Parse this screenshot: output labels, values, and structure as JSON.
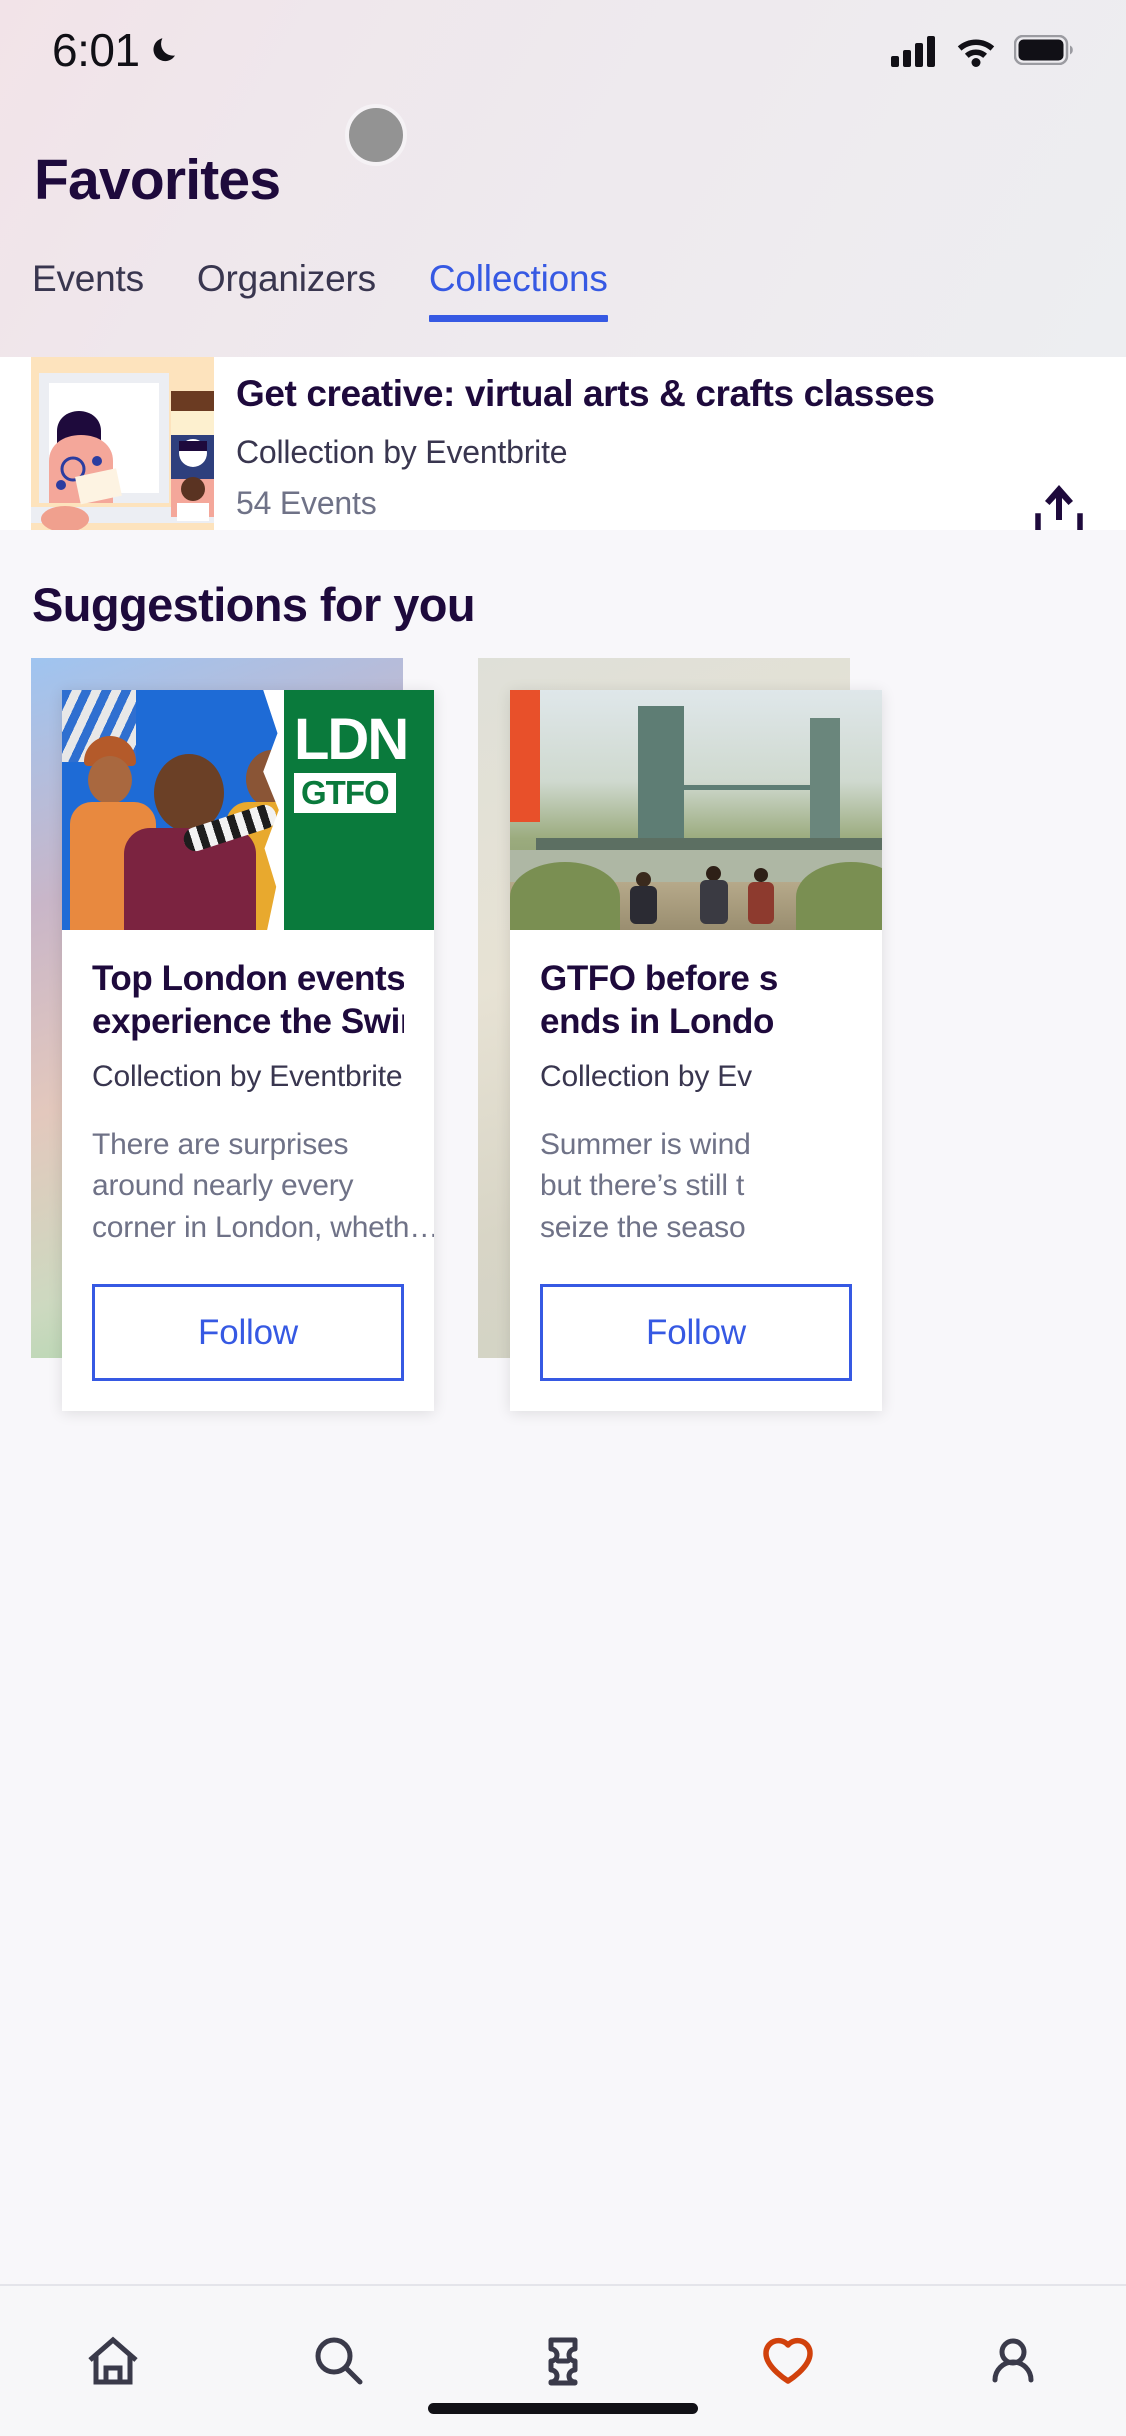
{
  "status_bar": {
    "time": "6:01",
    "moon_icon": "crescent-moon-icon",
    "cellular_icon": "cellular-signal-icon",
    "wifi_icon": "wifi-icon",
    "battery_icon": "battery-full-icon"
  },
  "header": {
    "title": "Favorites",
    "avatar": "user-avatar"
  },
  "tabs": [
    {
      "label": "Events",
      "active": false
    },
    {
      "label": "Organizers",
      "active": false
    },
    {
      "label": "Collections",
      "active": true
    }
  ],
  "saved_collection": {
    "thumbnail": "arts-crafts-illustration",
    "title": "Get creative: virtual arts & crafts classes",
    "subtitle": "Collection by Eventbrite",
    "count": "54 Events",
    "share_icon": "share-upload-icon"
  },
  "suggestions": {
    "heading": "Suggestions for you",
    "cards": [
      {
        "image": "ldn-gtfo-artwork",
        "image_text_primary": "LDN",
        "image_text_secondary": "GTFO",
        "title_line1": "Top London events:",
        "title_line2": "experience the Swin…",
        "subtitle": "Collection by Eventbrite",
        "desc_line1": "There are surprises",
        "desc_line2": "around nearly every",
        "desc_line3": "corner in London, wheth…",
        "button": "Follow"
      },
      {
        "image": "hammersmith-bridge-photo",
        "title_line1": "GTFO before s",
        "title_line2": "ends in Londo",
        "subtitle": "Collection by Ev",
        "desc_line1": "Summer is wind",
        "desc_line2": "but there’s still t",
        "desc_line3": "seize the seaso",
        "button": "Follow"
      }
    ]
  },
  "bottom_nav": [
    {
      "icon": "home-icon",
      "active": false
    },
    {
      "icon": "search-icon",
      "active": false
    },
    {
      "icon": "ticket-icon",
      "active": false
    },
    {
      "icon": "heart-icon",
      "active": true
    },
    {
      "icon": "profile-icon",
      "active": false
    }
  ],
  "colors": {
    "brand_blue": "#3659e3",
    "brand_purple": "#1e0a3c",
    "heart_red": "#d1410c",
    "muted_text": "#6f7287",
    "body_text": "#39364f"
  }
}
